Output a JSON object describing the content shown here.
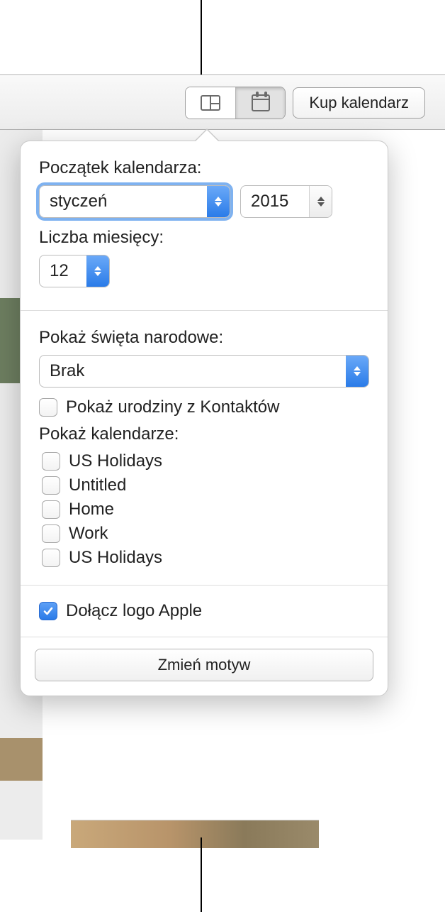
{
  "toolbar": {
    "buy_label": "Kup kalendarz"
  },
  "popover": {
    "start_label": "Początek kalendarza:",
    "month_value": "styczeń",
    "year_value": "2015",
    "months_count_label": "Liczba miesięcy:",
    "months_count_value": "12",
    "holidays_label": "Pokaż święta narodowe:",
    "holidays_value": "Brak",
    "birthdays_label": "Pokaż urodziny z Kontaktów",
    "birthdays_checked": false,
    "show_calendars_label": "Pokaż kalendarze:",
    "calendars": [
      {
        "label": "US Holidays",
        "checked": false
      },
      {
        "label": "Untitled",
        "checked": false
      },
      {
        "label": "Home",
        "checked": false
      },
      {
        "label": "Work",
        "checked": false
      },
      {
        "label": "US Holidays",
        "checked": false
      }
    ],
    "apple_logo_label": "Dołącz logo Apple",
    "apple_logo_checked": true,
    "change_theme_label": "Zmień motyw"
  }
}
